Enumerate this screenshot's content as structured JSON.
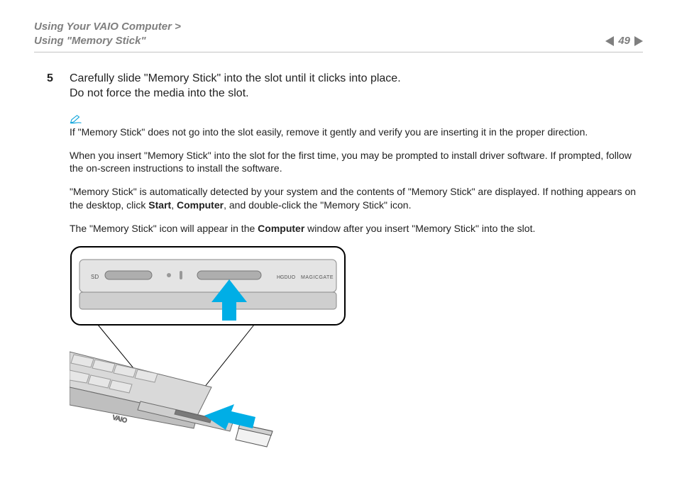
{
  "header": {
    "breadcrumb1": "Using Your VAIO Computer >",
    "breadcrumb2": "Using \"Memory Stick\"",
    "pageNumber": "49"
  },
  "step": {
    "number": "5",
    "line1": "Carefully slide \"Memory Stick\" into the slot until it clicks into place.",
    "line2": "Do not force the media into the slot."
  },
  "note": {
    "text": "If \"Memory Stick\" does not go into the slot easily, remove it gently and verify you are inserting it in the proper direction."
  },
  "paragraphs": {
    "p1": "When you insert \"Memory Stick\" into the slot for the first time, you may be prompted to install driver software. If prompted, follow the on-screen instructions to install the software.",
    "p2a": "\"Memory Stick\" is automatically detected by your system and the contents of \"Memory Stick\" are displayed. If nothing appears on the desktop, click ",
    "p2b_start": "Start",
    "p2b_sep": ", ",
    "p2b_computer": "Computer",
    "p2c": ", and double-click the \"Memory Stick\" icon.",
    "p3a": "The \"Memory Stick\" icon will appear in the ",
    "p3b": "Computer",
    "p3c": " window after you insert \"Memory Stick\" into the slot."
  },
  "figure": {
    "label_sd": "SD",
    "label_hgduo": "HGDUO",
    "label_magicgate": "MAGICGATE",
    "brand": "VAIO"
  }
}
